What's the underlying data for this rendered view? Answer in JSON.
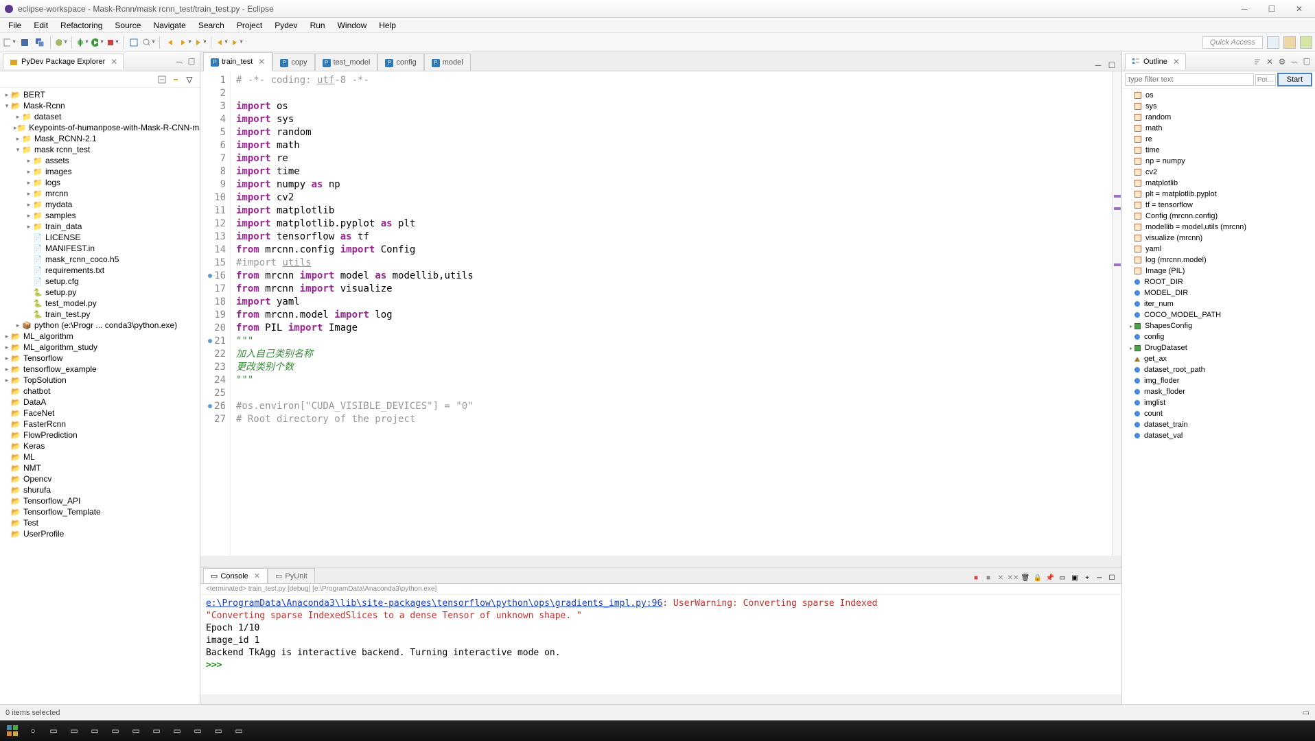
{
  "window": {
    "title": "eclipse-workspace - Mask-Rcnn/mask rcnn_test/train_test.py - Eclipse"
  },
  "menu": [
    "File",
    "Edit",
    "Refactoring",
    "Source",
    "Navigate",
    "Search",
    "Project",
    "Pydev",
    "Run",
    "Window",
    "Help"
  ],
  "quick_access": "Quick Access",
  "package_explorer": {
    "title": "PyDev Package Explorer",
    "tree": [
      {
        "depth": 0,
        "toggle": "▸",
        "icon": "proj-icon",
        "label": "BERT"
      },
      {
        "depth": 0,
        "toggle": "▾",
        "icon": "proj-icon",
        "label": "Mask-Rcnn"
      },
      {
        "depth": 1,
        "toggle": "▸",
        "icon": "folder-icon",
        "label": "dataset"
      },
      {
        "depth": 1,
        "toggle": "▸",
        "icon": "folder-icon",
        "label": "Keypoints-of-humanpose-with-Mask-R-CNN-master"
      },
      {
        "depth": 1,
        "toggle": "▸",
        "icon": "folder-icon",
        "label": "Mask_RCNN-2.1"
      },
      {
        "depth": 1,
        "toggle": "▾",
        "icon": "folder-icon",
        "label": "mask rcnn_test"
      },
      {
        "depth": 2,
        "toggle": "▸",
        "icon": "folder-icon",
        "label": "assets"
      },
      {
        "depth": 2,
        "toggle": "▸",
        "icon": "folder-icon",
        "label": "images"
      },
      {
        "depth": 2,
        "toggle": "▸",
        "icon": "folder-icon",
        "label": "logs"
      },
      {
        "depth": 2,
        "toggle": "▸",
        "icon": "folder-icon",
        "label": "mrcnn"
      },
      {
        "depth": 2,
        "toggle": "▸",
        "icon": "folder-icon",
        "label": "mydata"
      },
      {
        "depth": 2,
        "toggle": "▸",
        "icon": "folder-icon",
        "label": "samples"
      },
      {
        "depth": 2,
        "toggle": "▸",
        "icon": "folder-icon",
        "label": "train_data"
      },
      {
        "depth": 2,
        "toggle": "",
        "icon": "file-icon",
        "label": "LICENSE"
      },
      {
        "depth": 2,
        "toggle": "",
        "icon": "file-icon",
        "label": "MANIFEST.in"
      },
      {
        "depth": 2,
        "toggle": "",
        "icon": "file-icon",
        "label": "mask_rcnn_coco.h5"
      },
      {
        "depth": 2,
        "toggle": "",
        "icon": "file-icon",
        "label": "requirements.txt"
      },
      {
        "depth": 2,
        "toggle": "",
        "icon": "file-icon",
        "label": "setup.cfg"
      },
      {
        "depth": 2,
        "toggle": "",
        "icon": "pyfile-icon",
        "label": "setup.py"
      },
      {
        "depth": 2,
        "toggle": "",
        "icon": "pyfile-icon",
        "label": "test_model.py"
      },
      {
        "depth": 2,
        "toggle": "",
        "icon": "pyfile-icon",
        "label": "train_test.py"
      },
      {
        "depth": 1,
        "toggle": "▸",
        "icon": "pkg-icon",
        "label": "python  (e:\\Progr ... conda3\\python.exe)"
      },
      {
        "depth": 0,
        "toggle": "▸",
        "icon": "proj-icon",
        "label": "ML_algorithm"
      },
      {
        "depth": 0,
        "toggle": "▸",
        "icon": "proj-icon",
        "label": "ML_algorithm_study"
      },
      {
        "depth": 0,
        "toggle": "▸",
        "icon": "proj-icon",
        "label": "Tensorflow"
      },
      {
        "depth": 0,
        "toggle": "▸",
        "icon": "proj-icon",
        "label": "tensorflow_example"
      },
      {
        "depth": 0,
        "toggle": "▸",
        "icon": "proj-icon",
        "label": "TopSolution"
      },
      {
        "depth": 0,
        "toggle": "",
        "icon": "proj-icon",
        "label": "chatbot"
      },
      {
        "depth": 0,
        "toggle": "",
        "icon": "proj-icon",
        "label": "DataA"
      },
      {
        "depth": 0,
        "toggle": "",
        "icon": "proj-icon",
        "label": "FaceNet"
      },
      {
        "depth": 0,
        "toggle": "",
        "icon": "proj-icon",
        "label": "FasterRcnn"
      },
      {
        "depth": 0,
        "toggle": "",
        "icon": "proj-icon",
        "label": "FlowPrediction"
      },
      {
        "depth": 0,
        "toggle": "",
        "icon": "proj-icon",
        "label": "Keras"
      },
      {
        "depth": 0,
        "toggle": "",
        "icon": "proj-icon",
        "label": "ML"
      },
      {
        "depth": 0,
        "toggle": "",
        "icon": "proj-icon",
        "label": "NMT"
      },
      {
        "depth": 0,
        "toggle": "",
        "icon": "proj-icon",
        "label": "Opencv"
      },
      {
        "depth": 0,
        "toggle": "",
        "icon": "proj-icon",
        "label": "shurufa"
      },
      {
        "depth": 0,
        "toggle": "",
        "icon": "proj-icon",
        "label": "Tensorflow_API"
      },
      {
        "depth": 0,
        "toggle": "",
        "icon": "proj-icon",
        "label": "Tensorflow_Template"
      },
      {
        "depth": 0,
        "toggle": "",
        "icon": "proj-icon",
        "label": "Test"
      },
      {
        "depth": 0,
        "toggle": "",
        "icon": "proj-icon",
        "label": "UserProfile"
      }
    ]
  },
  "editor": {
    "tabs": [
      {
        "label": "train_test",
        "active": true
      },
      {
        "label": "copy",
        "active": false
      },
      {
        "label": "test_model",
        "active": false
      },
      {
        "label": "config",
        "active": false
      },
      {
        "label": "model",
        "active": false
      }
    ],
    "lines": [
      {
        "n": 1,
        "html": "<span class='cm'># -*- coding: <u>utf</u>-8 -*-</span>"
      },
      {
        "n": 2,
        "html": ""
      },
      {
        "n": 3,
        "html": "<span class='kw'>import</span> os"
      },
      {
        "n": 4,
        "html": "<span class='kw'>import</span> sys"
      },
      {
        "n": 5,
        "html": "<span class='kw'>import</span> random"
      },
      {
        "n": 6,
        "html": "<span class='kw'>import</span> math"
      },
      {
        "n": 7,
        "html": "<span class='kw'>import</span> re"
      },
      {
        "n": 8,
        "html": "<span class='kw'>import</span> time"
      },
      {
        "n": 9,
        "html": "<span class='kw'>import</span> numpy <span class='kw'>as</span> np"
      },
      {
        "n": 10,
        "html": "<span class='kw'>import</span> cv2"
      },
      {
        "n": 11,
        "html": "<span class='kw'>import</span> matplotlib"
      },
      {
        "n": 12,
        "html": "<span class='kw'>import</span> matplotlib.pyplot <span class='kw'>as</span> plt"
      },
      {
        "n": 13,
        "html": "<span class='kw'>import</span> tensorflow <span class='kw'>as</span> tf"
      },
      {
        "n": 14,
        "html": "<span class='kw'>from</span> mrcnn.config <span class='kw'>import</span> Config"
      },
      {
        "n": 15,
        "html": "<span class='cm'>#import <u>utils</u></span>"
      },
      {
        "n": 16,
        "html": "<span class='kw'>from</span> mrcnn <span class='kw'>import</span> model <span class='kw'>as</span> modellib,utils",
        "dot": true
      },
      {
        "n": 17,
        "html": "<span class='kw'>from</span> mrcnn <span class='kw'>import</span> visualize"
      },
      {
        "n": 18,
        "html": "<span class='kw'>import</span> yaml"
      },
      {
        "n": 19,
        "html": "<span class='kw'>from</span> mrcnn.model <span class='kw'>import</span> log"
      },
      {
        "n": 20,
        "html": "<span class='kw'>from</span> PIL <span class='kw'>import</span> Image"
      },
      {
        "n": 21,
        "html": "<span class='str'>\"\"\"</span>",
        "dot": true
      },
      {
        "n": 22,
        "html": "<span class='gr'>加入自己类别名称</span>"
      },
      {
        "n": 23,
        "html": "<span class='gr'>更改类别个数</span>"
      },
      {
        "n": 24,
        "html": "<span class='str'>\"\"\"</span>"
      },
      {
        "n": 25,
        "html": ""
      },
      {
        "n": 26,
        "html": "<span class='cm'>#os.environ[\"CUDA_VISIBLE_DEVICES\"] = \"0\"</span>",
        "dot": true
      },
      {
        "n": 27,
        "html": "<span class='cm'># Root directory of the project</span>"
      }
    ]
  },
  "console": {
    "tabs": [
      {
        "label": "Console",
        "active": true
      },
      {
        "label": "PyUnit",
        "active": false
      }
    ],
    "desc": "<terminated> train_test.py [debug] [e:\\ProgramData\\Anaconda3\\python.exe]",
    "line1_path": "e:\\ProgramData\\Anaconda3\\lib\\site-packages\\tensorflow\\python\\ops\\gradients_impl.py:96",
    "line1_rest": ": UserWarning: Converting sparse Indexed",
    "line2": "  \"Converting sparse IndexedSlices to a dense Tensor of unknown shape. \"",
    "line3": "Epoch 1/10",
    "line4": "image_id 1",
    "line5": "Backend TkAgg is interactive backend. Turning interactive mode on.",
    "prompt": ">>> "
  },
  "outline": {
    "title": "Outline",
    "filter_placeholder": "type filter text",
    "poi": "Poi...",
    "start": "Start",
    "items": [
      {
        "cls": "oimp",
        "label": "os"
      },
      {
        "cls": "oimp",
        "label": "sys"
      },
      {
        "cls": "oimp",
        "label": "random"
      },
      {
        "cls": "oimp",
        "label": "math"
      },
      {
        "cls": "oimp",
        "label": "re"
      },
      {
        "cls": "oimp",
        "label": "time"
      },
      {
        "cls": "oimp",
        "label": "np = numpy"
      },
      {
        "cls": "oimp",
        "label": "cv2"
      },
      {
        "cls": "oimp",
        "label": "matplotlib"
      },
      {
        "cls": "oimp",
        "label": "plt = matplotlib.pyplot"
      },
      {
        "cls": "oimp",
        "label": "tf = tensorflow"
      },
      {
        "cls": "oimp",
        "label": "Config (mrcnn.config)"
      },
      {
        "cls": "oimp",
        "label": "modellib = model,utils (mrcnn)"
      },
      {
        "cls": "oimp",
        "label": "visualize (mrcnn)"
      },
      {
        "cls": "oimp",
        "label": "yaml"
      },
      {
        "cls": "oimp",
        "label": "log (mrcnn.model)"
      },
      {
        "cls": "oimp",
        "label": "Image (PIL)"
      },
      {
        "cls": "ovar",
        "label": "ROOT_DIR"
      },
      {
        "cls": "ovar",
        "label": "MODEL_DIR"
      },
      {
        "cls": "ovar",
        "label": "iter_num"
      },
      {
        "cls": "ovar",
        "label": "COCO_MODEL_PATH"
      },
      {
        "cls": "ocls",
        "label": "ShapesConfig",
        "expand": true
      },
      {
        "cls": "ovar",
        "label": "config"
      },
      {
        "cls": "ocls",
        "label": "DrugDataset",
        "expand": true
      },
      {
        "cls": "ofunc",
        "label": "get_ax"
      },
      {
        "cls": "ovar",
        "label": "dataset_root_path"
      },
      {
        "cls": "ovar",
        "label": "img_floder"
      },
      {
        "cls": "ovar",
        "label": "mask_floder"
      },
      {
        "cls": "ovar",
        "label": "imglist"
      },
      {
        "cls": "ovar",
        "label": "count"
      },
      {
        "cls": "ovar",
        "label": "dataset_train"
      },
      {
        "cls": "ovar",
        "label": "dataset_val"
      }
    ]
  },
  "status": "0 items selected"
}
